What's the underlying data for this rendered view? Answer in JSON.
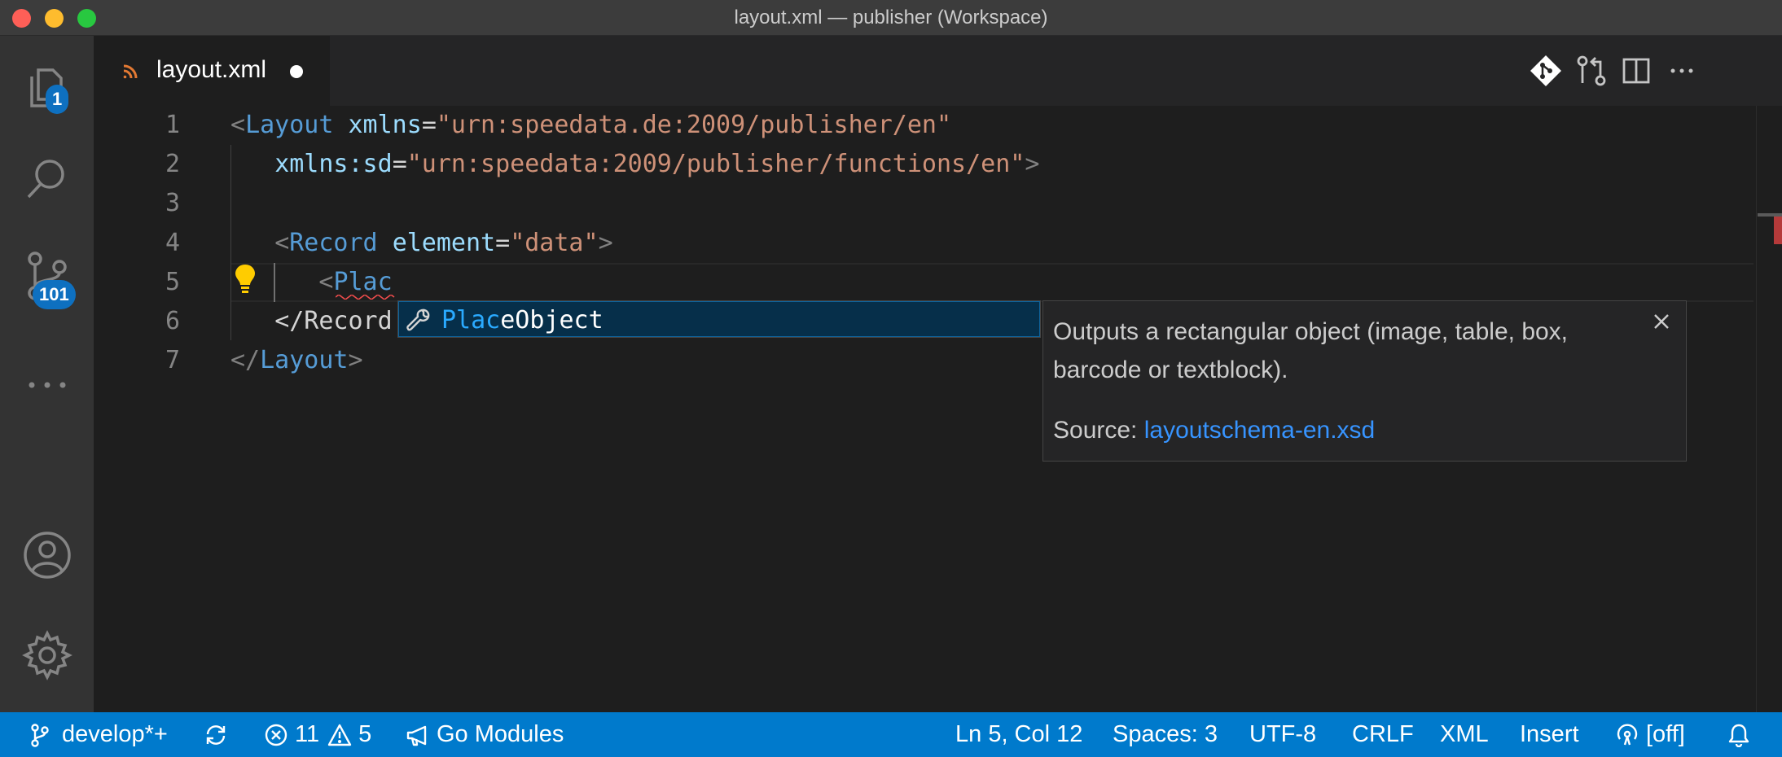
{
  "window": {
    "title": "layout.xml — publisher (Workspace)"
  },
  "activity_bar": {
    "explorer_badge": "1",
    "scm_badge": "101"
  },
  "tab": {
    "name": "layout.xml"
  },
  "editor": {
    "line_numbers": [
      "1",
      "2",
      "3",
      "4",
      "5",
      "6",
      "7"
    ],
    "lines": {
      "l1": {
        "open": "<",
        "tag": "Layout",
        "attr": "xmlns",
        "eq": "=",
        "val": "\"urn:speedata.de:2009/publisher/en\""
      },
      "l2": {
        "attr": "xmlns:sd",
        "eq": "=",
        "val": "\"urn:speedata:2009/publisher/functions/en\"",
        "close": ">"
      },
      "l4": {
        "open": "<",
        "tag": "Record",
        "attr": "element",
        "eq": "=",
        "val": "\"data\"",
        "close": ">"
      },
      "l5": {
        "open": "<",
        "tag": "Plac"
      },
      "l6": {
        "text": "</Record"
      },
      "l7": {
        "open": "</",
        "tag": "Layout",
        "close": ">"
      }
    }
  },
  "suggest": {
    "match": "Plac",
    "rest": "eObject"
  },
  "details": {
    "description": "Outputs a rectangular object (image, table, box, barcode or textblock).",
    "source_label": "Source:",
    "source_link": "layoutschema-en.xsd"
  },
  "status_bar": {
    "branch": "develop*+",
    "errors": "11",
    "warnings": "5",
    "go_modules": "Go Modules",
    "cursor": "Ln 5, Col 12",
    "spaces": "Spaces: 3",
    "encoding": "UTF-8",
    "eol": "CRLF",
    "language": "XML",
    "mode": "Insert",
    "live": "[off]"
  }
}
